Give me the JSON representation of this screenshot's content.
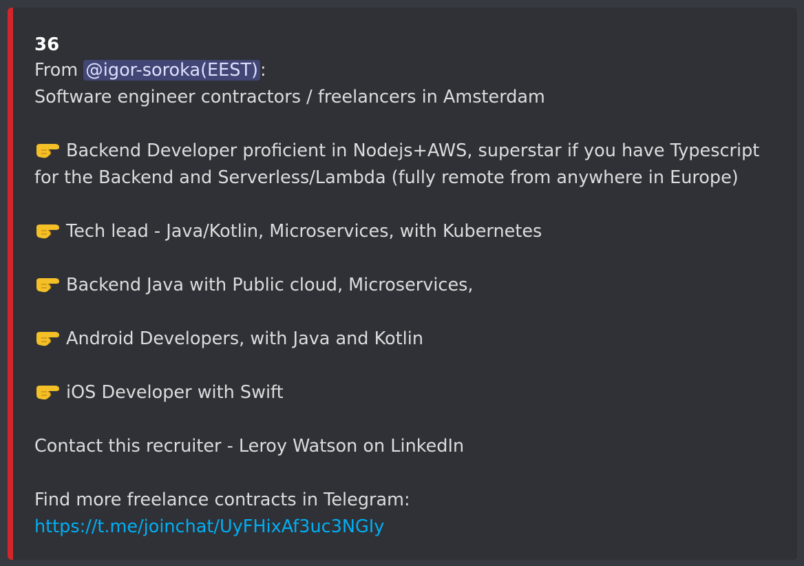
{
  "embed": {
    "accent_color": "#d3262a",
    "title": "36",
    "from_prefix": "From ",
    "mention": "@igor-soroka(EEST)",
    "from_suffix": ":",
    "subtitle": "Software engineer contractors / freelancers in Amsterdam",
    "items": [
      {
        "icon": "pointing-right-icon",
        "text": "Backend Developer proficient in Nodejs+AWS, superstar if you have Typescript for the Backend and Serverless/Lambda (fully remote from anywhere in Europe)"
      },
      {
        "icon": "pointing-right-icon",
        "text": "Tech lead - Java/Kotlin, Microservices, with Kubernetes"
      },
      {
        "icon": "pointing-right-icon",
        "text": "Backend Java with Public cloud, Microservices,"
      },
      {
        "icon": "pointing-right-icon",
        "text": "Android Developers, with Java and Kotlin"
      },
      {
        "icon": "pointing-right-icon",
        "text": "iOS Developer with Swift"
      }
    ],
    "contact": "Contact this recruiter - Leroy Watson on LinkedIn",
    "telegram_label": "Find more freelance contracts in Telegram:",
    "telegram_link": "https://t.me/joinchat/UyFHixAf3uc3NGIy"
  }
}
